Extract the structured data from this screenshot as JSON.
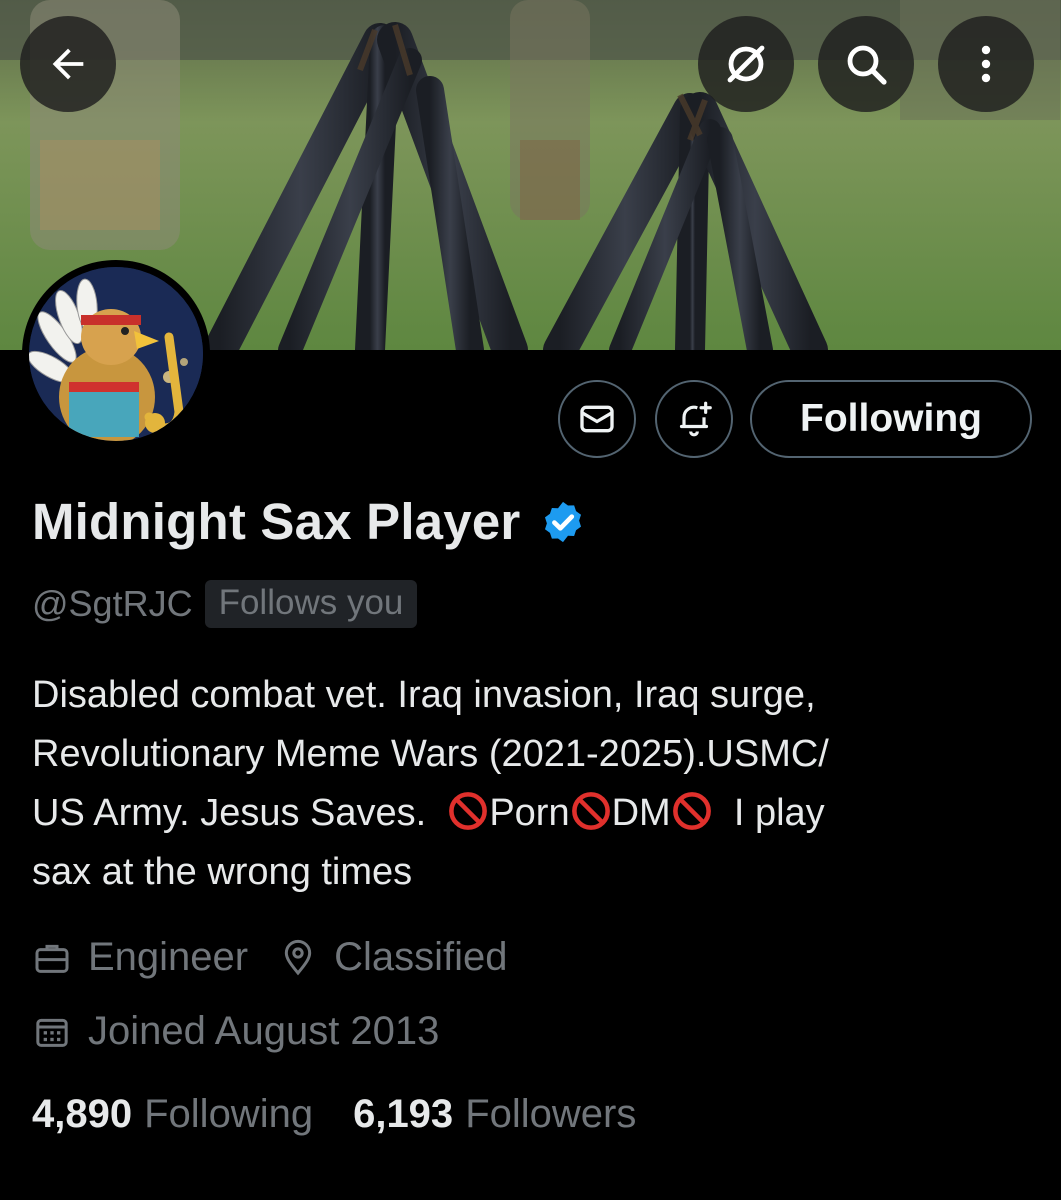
{
  "header": {
    "back_icon": "arrow-left-icon",
    "grok_icon": "grok-icon",
    "search_icon": "search-icon",
    "more_icon": "more-vertical-icon"
  },
  "profile": {
    "display_name": "Midnight Sax Player",
    "verified_color": "#1d9bf0",
    "handle": "@SgtRJC",
    "follows_you": "Follows you",
    "bio_lines": [
      "Disabled combat vet. Iraq invasion, Iraq surge,",
      "Revolutionary Meme Wars (2021-2025).USMC/"
    ],
    "bio_line3": {
      "a": "US Army. Jesus Saves.",
      "b": "Porn",
      "c": "DM",
      "d": "I play"
    },
    "bio_line4": "sax at the wrong times",
    "profession": "Engineer",
    "location": "Classified",
    "joined": "Joined August 2013"
  },
  "actions": {
    "message_icon": "envelope-icon",
    "notify_icon": "bell-plus-icon",
    "following_label": "Following"
  },
  "stats": {
    "following_count": "4,890",
    "following_label": "Following",
    "followers_count": "6,193",
    "followers_label": "Followers"
  }
}
